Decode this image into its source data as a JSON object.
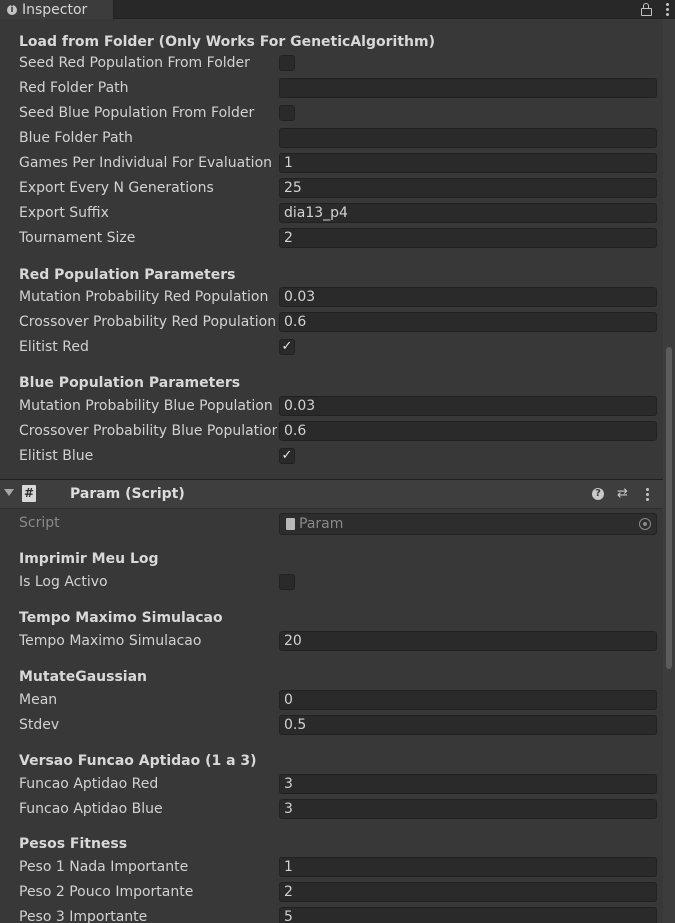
{
  "tab": {
    "title": "Inspector"
  },
  "load_folder": {
    "header": "Load from Folder (Only Works For GeneticAlgorithm)",
    "seed_red_label": "Seed Red Population From Folder",
    "seed_red_checked": false,
    "red_path_label": "Red Folder Path",
    "red_path_value": "",
    "seed_blue_label": "Seed Blue Population From Folder",
    "seed_blue_checked": false,
    "blue_path_label": "Blue Folder Path",
    "blue_path_value": "",
    "games_label": "Games Per Individual For Evaluation",
    "games_value": "1",
    "export_n_label": "Export Every N Generations",
    "export_n_value": "25",
    "export_suffix_label": "Export Suffix",
    "export_suffix_value": "dia13_p4",
    "tournament_label": "Tournament Size",
    "tournament_value": "2"
  },
  "red_pop": {
    "header": "Red Population Parameters",
    "mutation_label": "Mutation Probability Red Population",
    "mutation_value": "0.03",
    "crossover_label": "Crossover Probability Red Population",
    "crossover_value": "0.6",
    "elitist_label": "Elitist Red",
    "elitist_checked": true
  },
  "blue_pop": {
    "header": "Blue Population Parameters",
    "mutation_label": "Mutation Probability Blue Population",
    "mutation_value": "0.03",
    "crossover_label": "Crossover Probability Blue Population",
    "crossover_value": "0.6",
    "elitist_label": "Elitist Blue",
    "elitist_checked": true
  },
  "component": {
    "title": "Param (Script)",
    "script_glyph": "#",
    "script_label": "Script",
    "script_value": "Param"
  },
  "log": {
    "header": "Imprimir Meu Log",
    "active_label": "Is Log Activo",
    "active_checked": false
  },
  "tempo": {
    "header": "Tempo Maximo Simulacao",
    "label": "Tempo Maximo Simulacao",
    "value": "20"
  },
  "gauss": {
    "header": "MutateGaussian",
    "mean_label": "Mean",
    "mean_value": "0",
    "stdev_label": "Stdev",
    "stdev_value": "0.5"
  },
  "versao": {
    "header": "Versao Funcao Aptidao (1 a 3)",
    "red_label": "Funcao Aptidao Red",
    "red_value": "3",
    "blue_label": "Funcao Aptidao Blue",
    "blue_value": "3"
  },
  "pesos": {
    "header": "Pesos Fitness",
    "p1_label": "Peso 1 Nada Importante",
    "p1_value": "1",
    "p2_label": "Peso 2 Pouco Importante",
    "p2_value": "2",
    "p3_label": "Peso 3 Importante",
    "p3_value": "5"
  },
  "icons": {
    "tab": "info-icon",
    "lock": "lock-icon",
    "menu": "kebab-menu-icon",
    "help": "help-icon",
    "presets": "presets-icon",
    "script": "script-icon",
    "target": "object-picker-icon"
  },
  "checkmark": "✓"
}
